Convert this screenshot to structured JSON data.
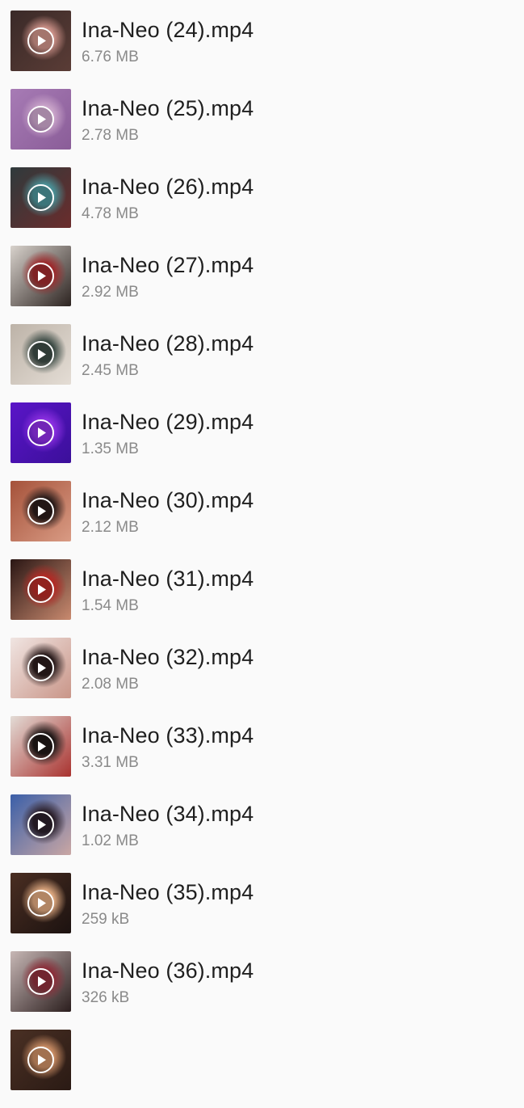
{
  "files": [
    {
      "name": "Ina-Neo (24).mp4",
      "size": "6.76 MB",
      "thumb_colors": [
        "#3a2a28",
        "#c98f86",
        "#5a3c36"
      ],
      "icon": "play-icon"
    },
    {
      "name": "Ina-Neo (25).mp4",
      "size": "2.78 MB",
      "thumb_colors": [
        "#a77bb5",
        "#c9a4c9",
        "#8a5d98"
      ],
      "icon": "play-icon"
    },
    {
      "name": "Ina-Neo (26).mp4",
      "size": "4.78 MB",
      "thumb_colors": [
        "#2f3a3c",
        "#4a8f95",
        "#6b2c2c"
      ],
      "icon": "play-icon"
    },
    {
      "name": "Ina-Neo (27).mp4",
      "size": "2.92 MB",
      "thumb_colors": [
        "#d8d2cc",
        "#9c2a2c",
        "#2c2320"
      ],
      "icon": "play-icon"
    },
    {
      "name": "Ina-Neo (28).mp4",
      "size": "2.45 MB",
      "thumb_colors": [
        "#bdb3a8",
        "#3b4a44",
        "#e4ddd5"
      ],
      "icon": "play-icon"
    },
    {
      "name": "Ina-Neo (29).mp4",
      "size": "1.35 MB",
      "thumb_colors": [
        "#5a15c8",
        "#8b2fe0",
        "#3b0f9a"
      ],
      "icon": "play-icon"
    },
    {
      "name": "Ina-Neo (30).mp4",
      "size": "2.12 MB",
      "thumb_colors": [
        "#a5523a",
        "#2a1c1a",
        "#d99b84"
      ],
      "icon": "play-icon"
    },
    {
      "name": "Ina-Neo (31).mp4",
      "size": "1.54 MB",
      "thumb_colors": [
        "#2a1614",
        "#b12a25",
        "#c98a6f"
      ],
      "icon": "play-icon"
    },
    {
      "name": "Ina-Neo (32).mp4",
      "size": "2.08 MB",
      "thumb_colors": [
        "#f0e5e2",
        "#2a1c1c",
        "#c99588"
      ],
      "icon": "play-icon"
    },
    {
      "name": "Ina-Neo (33).mp4",
      "size": "3.31 MB",
      "thumb_colors": [
        "#e3dcd6",
        "#1f1817",
        "#a9322f"
      ],
      "icon": "play-icon"
    },
    {
      "name": "Ina-Neo (34).mp4",
      "size": "1.02 MB",
      "thumb_colors": [
        "#3b5fa8",
        "#2a1f2a",
        "#caa7a4"
      ],
      "icon": "play-icon"
    },
    {
      "name": "Ina-Neo (35).mp4",
      "size": "259 kB",
      "thumb_colors": [
        "#4a2e22",
        "#d9a47c",
        "#1c1210"
      ],
      "icon": "play-icon"
    },
    {
      "name": "Ina-Neo (36).mp4",
      "size": "326 kB",
      "thumb_colors": [
        "#c7b7b5",
        "#8a2f3a",
        "#2b1e1e"
      ],
      "icon": "play-icon"
    },
    {
      "name": "",
      "size": "",
      "thumb_colors": [
        "#4a3024",
        "#c68a62",
        "#2a1a14"
      ],
      "icon": "play-icon"
    }
  ]
}
